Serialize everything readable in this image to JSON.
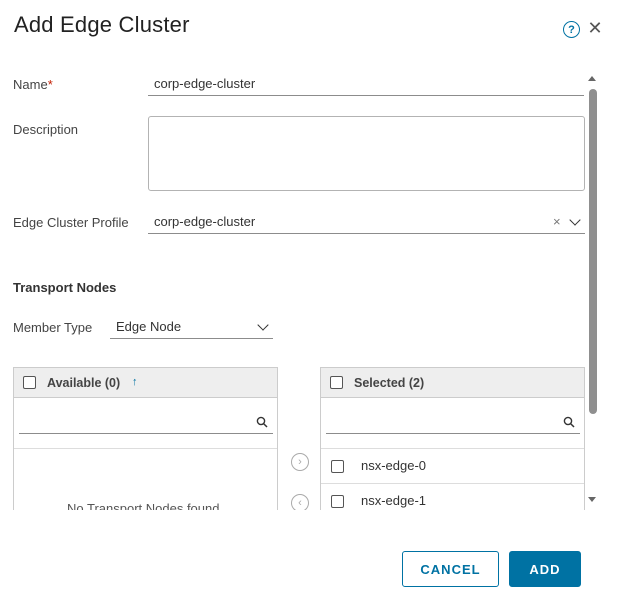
{
  "dialog": {
    "title": "Add Edge Cluster",
    "help_icon_glyph": "?",
    "close_icon_glyph": "✕"
  },
  "form": {
    "name_label": "Name",
    "required_marker": "*",
    "name_value": "corp-edge-cluster",
    "description_label": "Description",
    "description_value": "",
    "profile_label": "Edge Cluster Profile",
    "profile_value": "corp-edge-cluster",
    "clear_glyph": "×"
  },
  "transport_nodes": {
    "section_title": "Transport Nodes",
    "member_type_label": "Member Type",
    "member_type_value": "Edge Node",
    "available": {
      "title": "Available (0)",
      "sort_glyph": "↑",
      "search_value": "",
      "empty_message": "No Transport Nodes found"
    },
    "selected": {
      "title": "Selected (2)",
      "search_value": "",
      "items": [
        {
          "label": "nsx-edge-0"
        },
        {
          "label": "nsx-edge-1"
        }
      ]
    },
    "move_right_glyph": "›",
    "move_left_glyph": "‹"
  },
  "footer": {
    "cancel_label": "CANCEL",
    "add_label": "ADD"
  },
  "colors": {
    "accent": "#0072a3",
    "required": "#c21d00",
    "panel_header_bg": "#eeeeee",
    "scrollbar_thumb": "#8f8f8f"
  },
  "icons": {
    "help": "help-circle-icon",
    "close": "close-icon",
    "clear": "clear-icon",
    "dropdown": "chevron-down-icon",
    "search": "search-icon",
    "sort": "sort-ascending-icon",
    "move_right": "arrow-right-circle-icon",
    "move_left": "arrow-left-circle-icon"
  }
}
